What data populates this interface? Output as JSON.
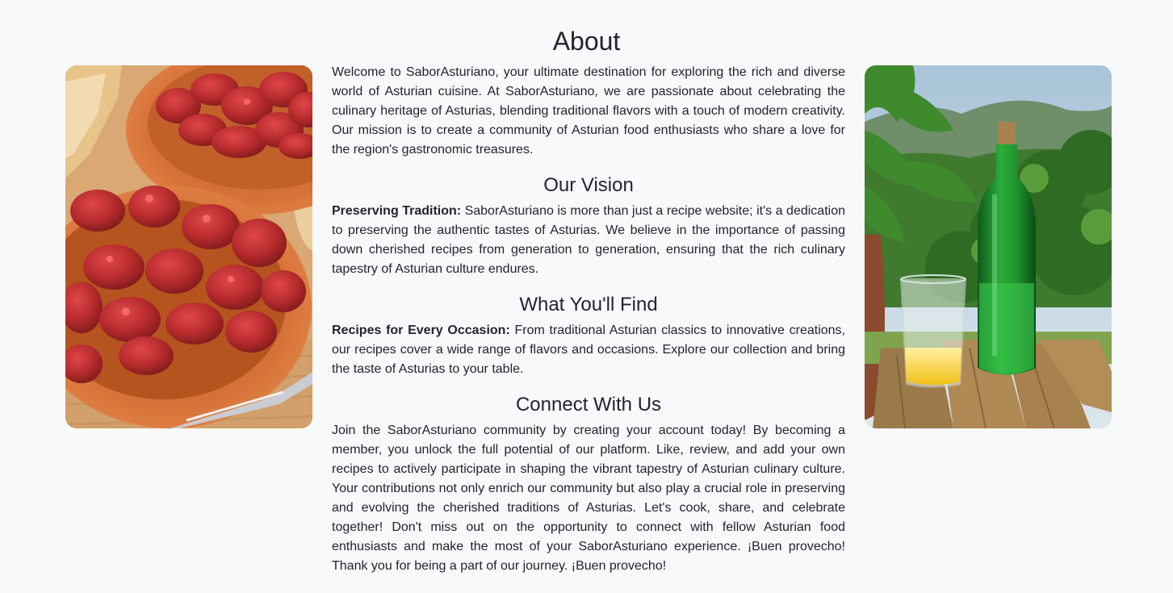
{
  "about": {
    "title": "About",
    "intro": "Welcome to SaborAsturiano, your ultimate destination for exploring the rich and diverse world of Asturian cuisine. At SaborAsturiano, we are passionate about celebrating the culinary heritage of Asturias, blending traditional flavors with a touch of modern creativity. Our mission is to create a community of Asturian food enthusiasts who share a love for the region's gastronomic treasures."
  },
  "vision": {
    "heading": "Our Vision",
    "lead": "Preserving Tradition:",
    "text": " SaborAsturiano is more than just a recipe website; it's a dedication to preserving the authentic tastes of Asturias. We believe in the importance of passing down cherished recipes from generation to generation, ensuring that the rich culinary tapestry of Asturian culture endures."
  },
  "find": {
    "heading": "What You'll Find",
    "lead": "Recipes for Every Occasion:",
    "text": " From traditional Asturian classics to innovative creations, our recipes cover a wide range of flavors and occasions. Explore our collection and bring the taste of Asturias to your table."
  },
  "connect": {
    "heading": "Connect With Us",
    "text": "Join the SaborAsturiano community by creating your account today! By becoming a member, you unlock the full potential of our platform. Like, review, and add your own recipes to actively participate in shaping the vibrant tapestry of Asturian culinary culture. Your contributions not only enrich our community but also play a crucial role in preserving and evolving the cherished traditions of Asturias. Let's cook, share, and celebrate together! Don't miss out on the opportunity to connect with fellow Asturian food enthusiasts and make the most of your SaborAsturiano experience. ¡Buen provecho! Thank you for being a part of our journey. ¡Buen provecho!"
  },
  "images": {
    "left": "chorizo-bowls-photo",
    "right": "cider-bottle-photo"
  },
  "colors": {
    "background": "#f8f9fa",
    "text": "#212529"
  }
}
